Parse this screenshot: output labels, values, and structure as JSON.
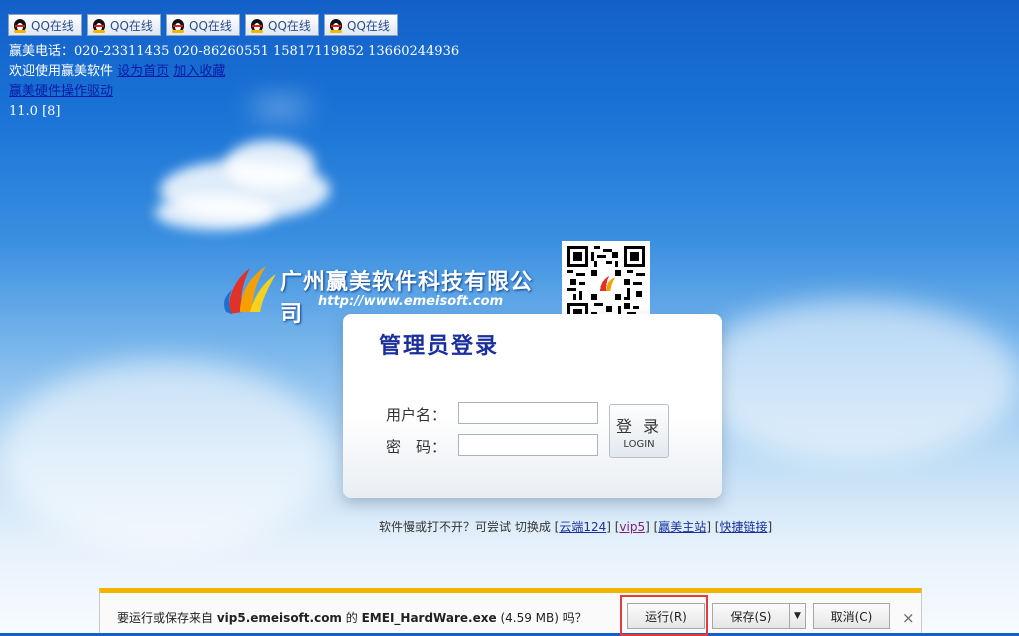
{
  "topbar": {
    "qq_buttons": [
      "QQ在线",
      "QQ在线",
      "QQ在线",
      "QQ在线",
      "QQ在线"
    ]
  },
  "info": {
    "phone": "赢美电话：020-23311435 020-86260551 15817119852 13660244936",
    "welcome": "欢迎使用赢美软件",
    "set_home": "设为首页",
    "add_fav": "加入收藏",
    "driver_link": "赢美硬件操作驱动",
    "version": "11.0 [8]"
  },
  "logo": {
    "company": "广州赢美软件科技有限公司",
    "url": "http://www.emeisoft.com"
  },
  "login": {
    "title": "管理员登录",
    "username_label": "用户名：",
    "password_label": "密　码：",
    "username_value": "",
    "password_value": "",
    "button_cn": "登 录",
    "button_en": "LOGIN"
  },
  "hint": {
    "text": "软件慢或打不开？可尝试 切换成",
    "links": [
      "云端124",
      "vip5",
      "赢美主站",
      "快捷链接"
    ]
  },
  "download_bar": {
    "prefix": "要运行或保存来自",
    "host": "vip5.emeisoft.com",
    "de": "的",
    "file": "EMEI_HardWare.exe",
    "size": "(4.59 MB)",
    "suffix": "吗？",
    "run": "运行(R)",
    "save": "保存(S)",
    "cancel": "取消(C)",
    "close": "×"
  },
  "colors": {
    "sky_top": "#1360c8",
    "title_blue": "#1a2f9c",
    "bar_accent": "#f1b500",
    "highlight_red": "#e53b3b"
  }
}
